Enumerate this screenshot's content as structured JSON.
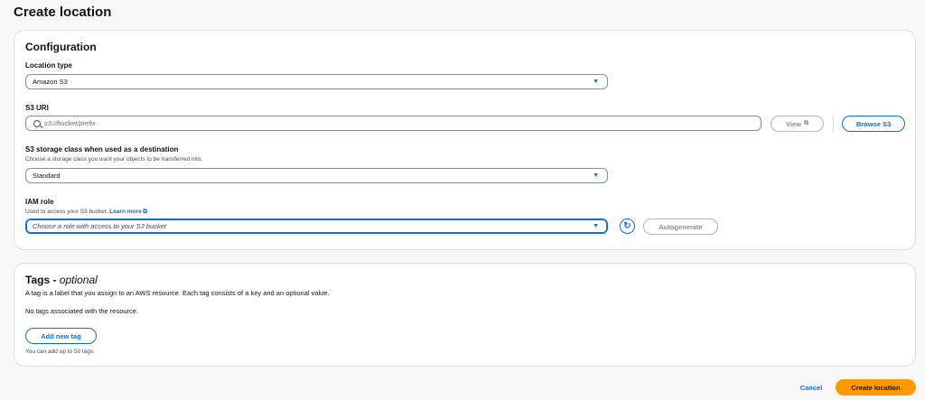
{
  "page": {
    "title": "Create location"
  },
  "config": {
    "title": "Configuration",
    "location_type": {
      "label": "Location type",
      "value": "Amazon S3"
    },
    "s3_uri": {
      "label": "S3 URI",
      "placeholder": "s3://bucket/prefix",
      "view_label": "View",
      "browse_label": "Browse S3"
    },
    "storage_class": {
      "label": "S3 storage class when used as a destination",
      "description": "Choose a storage class you want your objects to be transferred into.",
      "value": "Standard"
    },
    "iam_role": {
      "label": "IAM role",
      "description": "Used to access your S3 bucket.",
      "learn_more": "Learn more",
      "placeholder": "Choose a role with access to your S3 bucket",
      "autogenerate_label": "Autogenerate"
    }
  },
  "tags": {
    "title": "Tags - ",
    "title_optional": "optional",
    "description": "A tag is a label that you assign to an AWS resource. Each tag consists of a key and an optional value.",
    "empty_text": "No tags associated with the resource.",
    "add_label": "Add new tag",
    "limit_text": "You can add up to 50 tags."
  },
  "footer": {
    "cancel_label": "Cancel",
    "create_label": "Create location"
  },
  "colors": {
    "accent": "#0972d3",
    "cta": "#ff9900",
    "border": "#8c8c94"
  },
  "icons": [
    "search-icon",
    "external-link-icon",
    "caret-down-icon",
    "refresh-icon"
  ]
}
